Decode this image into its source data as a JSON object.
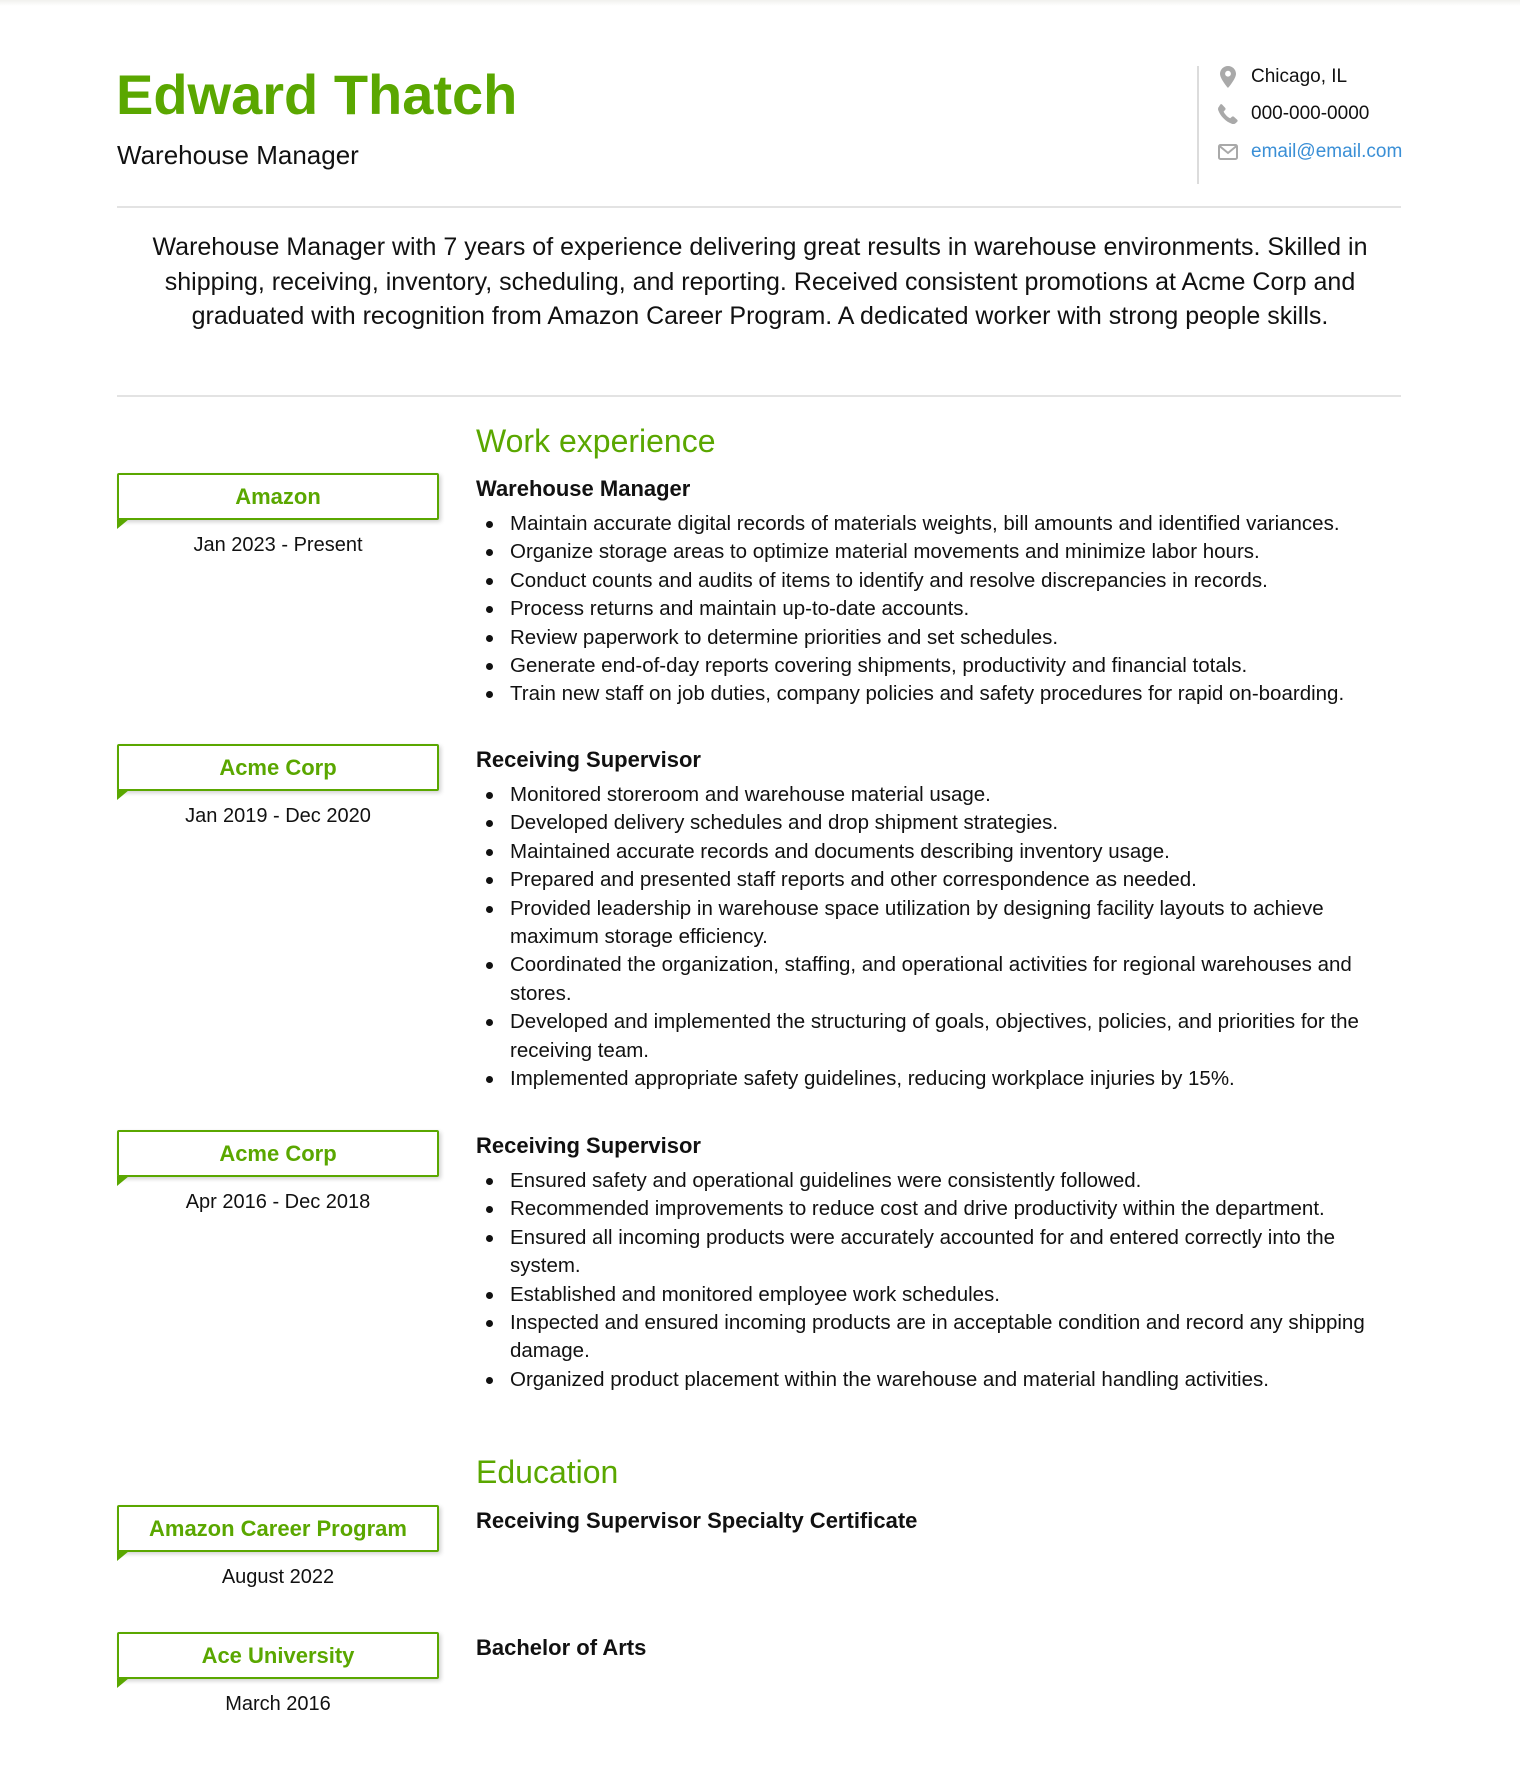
{
  "header": {
    "name": "Edward Thatch",
    "title": "Warehouse Manager",
    "contact": {
      "location": {
        "icon": "map-pin-icon",
        "text": "Chicago, IL"
      },
      "phone": {
        "icon": "phone-icon",
        "text": "000-000-0000"
      },
      "email": {
        "icon": "envelope-icon",
        "text": "email@email.com"
      }
    }
  },
  "summary": "Warehouse Manager with 7 years of experience delivering great results in warehouse environments. Skilled in shipping, receiving, inventory, scheduling, and reporting. Received consistent promotions at Acme Corp and graduated with recognition from Amazon Career Program. A dedicated worker with strong people skills.",
  "colors": {
    "accent": "#5aa700",
    "link": "#3a8fd6",
    "icon": "#a9a9a9",
    "rule": "#e3e3e3"
  },
  "work": {
    "heading": "Work experience",
    "entries": [
      {
        "company": "Amazon",
        "dates": "Jan 2023 - Present",
        "role": "Warehouse Manager",
        "bullets": [
          "Maintain accurate digital records of materials weights, bill amounts and identified variances.",
          "Organize storage areas to optimize material movements and minimize labor hours.",
          "Conduct counts and audits of items to identify and resolve discrepancies in records.",
          "Process returns and maintain up-to-date accounts.",
          "Review paperwork to determine priorities and set schedules.",
          "Generate end-of-day reports covering shipments, productivity and financial totals.",
          "Train new staff on job duties, company policies and safety procedures for rapid on-boarding."
        ]
      },
      {
        "company": "Acme Corp",
        "dates": "Jan 2019 - Dec 2020",
        "role": "Receiving Supervisor",
        "bullets": [
          "Monitored storeroom and warehouse material usage.",
          "Developed delivery schedules and drop shipment strategies.",
          "Maintained accurate records and documents describing inventory usage.",
          "Prepared and presented staff reports and other correspondence as needed.",
          "Provided leadership in warehouse space utilization by designing facility layouts to achieve maximum storage efficiency.",
          "Coordinated the organization, staffing, and operational activities for regional warehouses and stores.",
          "Developed and implemented the structuring of goals, objectives, policies, and priorities for the receiving team.",
          "Implemented appropriate safety guidelines, reducing workplace injuries by 15%."
        ]
      },
      {
        "company": "Acme Corp",
        "dates": "Apr 2016 - Dec 2018",
        "role": "Receiving Supervisor",
        "bullets": [
          "Ensured safety and operational guidelines were consistently followed.",
          "Recommended improvements to reduce cost and drive productivity within the department.",
          "Ensured all incoming products were accurately accounted for and entered correctly into the system.",
          "Established and monitored employee work schedules.",
          "Inspected and ensured incoming products are in acceptable condition and record any shipping damage.",
          "Organized product placement within the warehouse and material handling activities."
        ]
      }
    ]
  },
  "education": {
    "heading": "Education",
    "entries": [
      {
        "school": "Amazon Career Program",
        "date": "August 2022",
        "degree": "Receiving Supervisor Specialty Certificate"
      },
      {
        "school": "Ace University",
        "date": "March 2016",
        "degree": "Bachelor of Arts"
      }
    ]
  }
}
